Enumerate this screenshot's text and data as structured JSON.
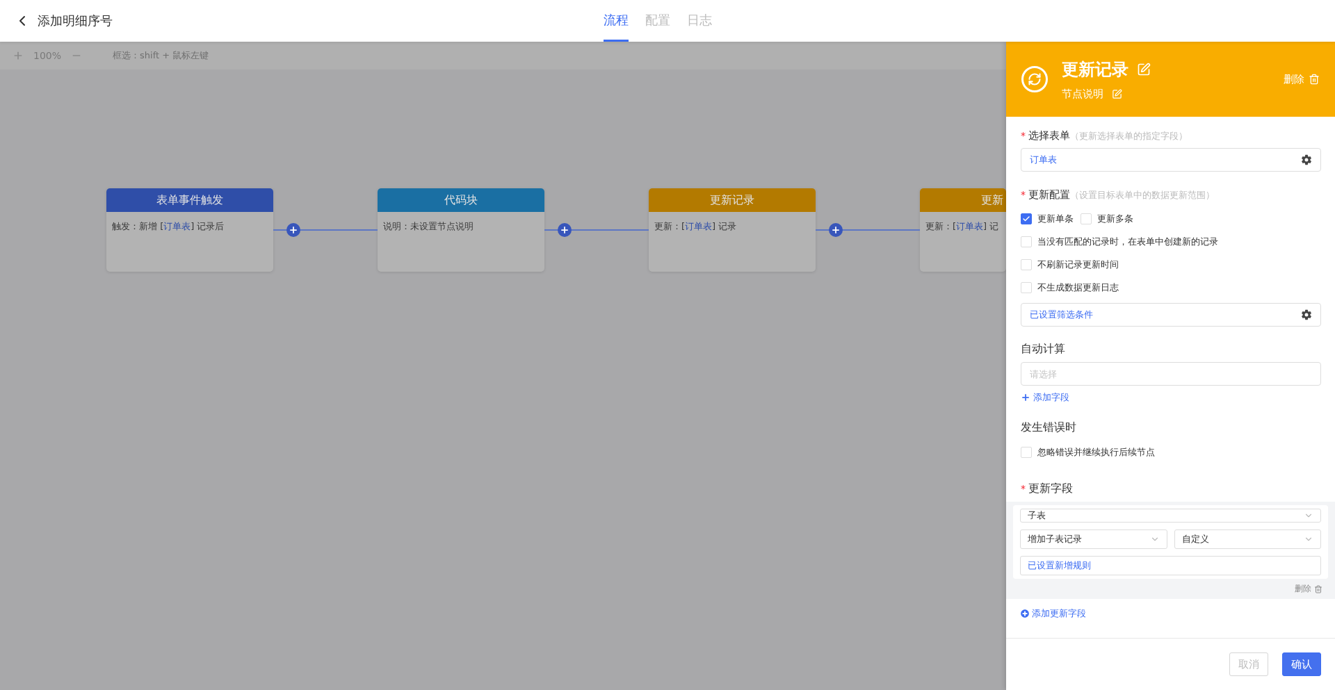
{
  "header": {
    "title": "添加明细序号",
    "tabs": [
      {
        "label": "流程",
        "selected": true
      },
      {
        "label": "配置",
        "selected": false
      },
      {
        "label": "日志",
        "selected": false
      }
    ]
  },
  "toolbar": {
    "zoom": "100%",
    "hint": "框选：shift + 鼠标左键"
  },
  "nodes": [
    {
      "kind": "trigger",
      "title": "表单事件触发",
      "prefix": "触发：新增 [",
      "link": "订单表",
      "suffix": "] 记录后",
      "clipped": false
    },
    {
      "kind": "code",
      "title": "代码块",
      "prefix": "说明：未设置节点说明",
      "clipped": false
    },
    {
      "kind": "update",
      "title": "更新记录",
      "prefix": "更新：[",
      "link": "订单表",
      "suffix": "] 记录",
      "clipped": false
    },
    {
      "kind": "update",
      "title": "更新",
      "prefix": "更新：[",
      "link": "订单表",
      "suffix": "] 记",
      "clipped": true
    }
  ],
  "panel": {
    "title": "更新记录",
    "subtitle": "节点说明",
    "delete": "删除",
    "form": {
      "mark": "*",
      "label": "选择表单",
      "hint": "（更新选择表单的指定字段）",
      "value": "订单表"
    },
    "config": {
      "mark": "*",
      "label": "更新配置",
      "hint": "（设置目标表单中的数据更新范围）",
      "mode_options": [
        {
          "label": "更新单条",
          "checked": true
        },
        {
          "label": "更新多条",
          "checked": false
        }
      ],
      "options": [
        {
          "label": "当没有匹配的记录时，在表单中创建新的记录",
          "checked": false
        },
        {
          "label": "不刷新记录更新时间",
          "checked": false
        },
        {
          "label": "不生成数据更新日志",
          "checked": false
        }
      ],
      "filter": "已设置筛选条件"
    },
    "auto_calc": {
      "label": "自动计算",
      "placeholder": "请选择",
      "add": "添加字段"
    },
    "on_error": {
      "label": "发生错误时",
      "options": [
        {
          "label": "忽略错误并继续执行后续节点",
          "checked": false
        }
      ]
    },
    "update_fields": {
      "mark": "*",
      "label": "更新字段",
      "items": [
        {
          "field": "子表",
          "action": "增加子表记录",
          "mode": "自定义",
          "rule": "已设置新增规则",
          "delete": "删除"
        }
      ],
      "add": "添加更新字段"
    },
    "footer": {
      "cancel": "取消",
      "cancel_disabled": true,
      "confirm": "确认"
    }
  }
}
